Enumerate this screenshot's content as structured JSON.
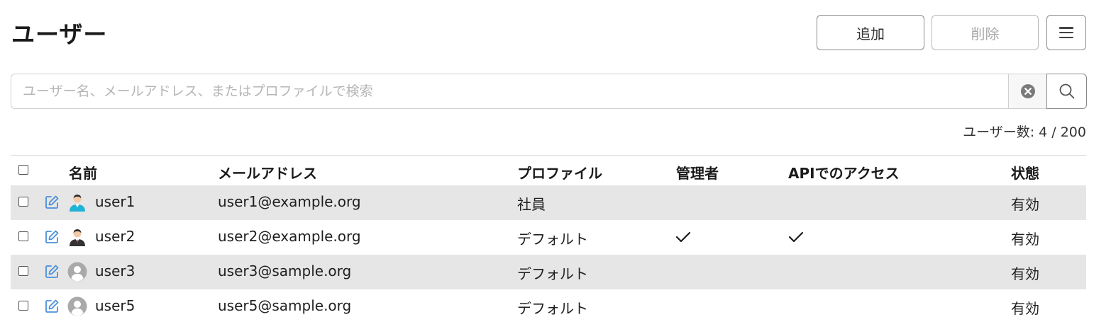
{
  "header": {
    "title": "ユーザー",
    "add_label": "追加",
    "delete_label": "削除"
  },
  "search": {
    "placeholder": "ユーザー名、メールアドレス、またはプロファイルで検索"
  },
  "count_text": "ユーザー数: 4 / 200",
  "table": {
    "columns": {
      "name": "名前",
      "email": "メールアドレス",
      "profile": "プロファイル",
      "admin": "管理者",
      "api": "APIでのアクセス",
      "status": "状態"
    },
    "rows": [
      {
        "name": "user1",
        "email": "user1@example.org",
        "profile": "社員",
        "admin": false,
        "api": false,
        "status": "有効",
        "avatar": "person-cyan-icon"
      },
      {
        "name": "user2",
        "email": "user2@example.org",
        "profile": "デフォルト",
        "admin": true,
        "api": true,
        "status": "有効",
        "avatar": "person-suit-icon"
      },
      {
        "name": "user3",
        "email": "user3@sample.org",
        "profile": "デフォルト",
        "admin": false,
        "api": false,
        "status": "有効",
        "avatar": "default-avatar-icon"
      },
      {
        "name": "user5",
        "email": "user5@sample.org",
        "profile": "デフォルト",
        "admin": false,
        "api": false,
        "status": "有効",
        "avatar": "default-avatar-icon"
      }
    ]
  },
  "colors": {
    "edit_icon": "#4a90d9",
    "row_shade": "#e6e6e6"
  }
}
